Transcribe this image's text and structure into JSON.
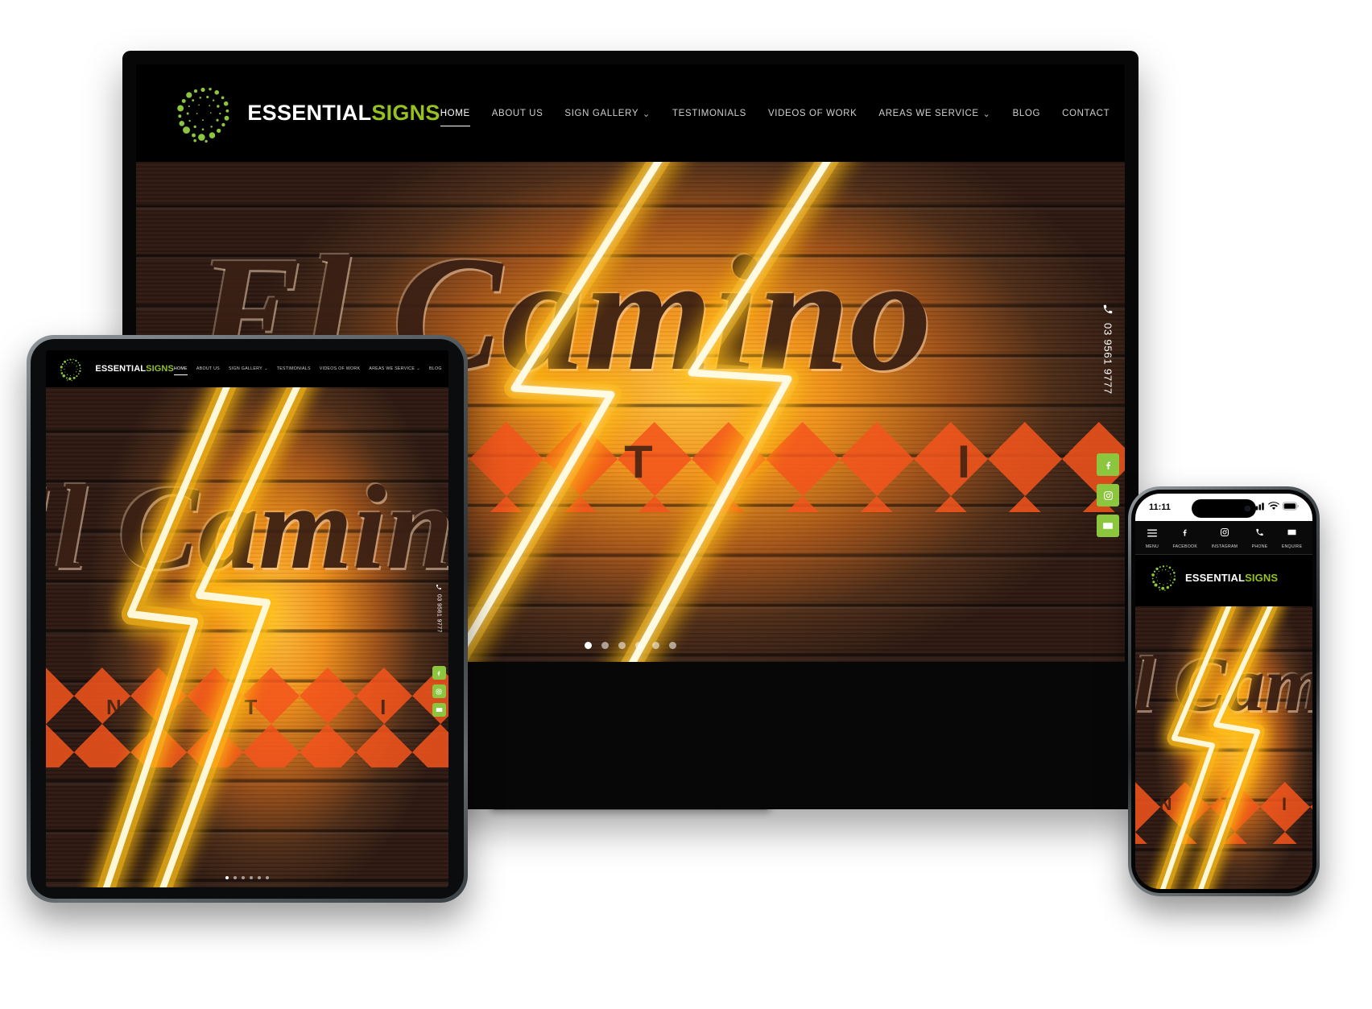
{
  "brand": {
    "name_part1": "ESSENTIAL",
    "name_part2": "SIGNS",
    "logo_icon": "dot-swirl-logo-icon",
    "accent_color": "#96c11f",
    "button_green": "#8cc63e"
  },
  "nav": {
    "items": [
      {
        "label": "HOME",
        "active": true,
        "has_dropdown": false
      },
      {
        "label": "ABOUT US",
        "active": false,
        "has_dropdown": false
      },
      {
        "label": "SIGN GALLERY",
        "active": false,
        "has_dropdown": true
      },
      {
        "label": "TESTIMONIALS",
        "active": false,
        "has_dropdown": false
      },
      {
        "label": "VIDEOS OF WORK",
        "active": false,
        "has_dropdown": false
      },
      {
        "label": "AREAS WE SERVICE",
        "active": false,
        "has_dropdown": true
      },
      {
        "label": "BLOG",
        "active": false,
        "has_dropdown": false
      },
      {
        "label": "CONTACT",
        "active": false,
        "has_dropdown": false
      }
    ]
  },
  "rail": {
    "phone_number": "03 9561 9777",
    "phone_icon": "phone-handset-icon",
    "socials": [
      {
        "name": "facebook",
        "icon": "facebook-icon"
      },
      {
        "name": "instagram",
        "icon": "instagram-icon"
      },
      {
        "name": "email",
        "icon": "envelope-icon"
      }
    ]
  },
  "hero": {
    "image_alt": "El Camino neon lightning bolt sign on reclaimed timber wall",
    "script_text": "El Camino",
    "diamond_letters": [
      "N",
      "T",
      "I"
    ],
    "slider_dots": 6,
    "active_dot": 1
  },
  "phone_device": {
    "status_time": "11:11",
    "signal_icon": "cellular-bars-icon",
    "wifi_icon": "wifi-icon",
    "battery_icon": "battery-icon",
    "quick_nav": [
      {
        "label": "MENU",
        "icon": "hamburger-icon"
      },
      {
        "label": "FACEBOOK",
        "icon": "facebook-icon"
      },
      {
        "label": "INSTAGRAM",
        "icon": "instagram-icon"
      },
      {
        "label": "PHONE",
        "icon": "phone-handset-icon"
      },
      {
        "label": "ENQUIRE",
        "icon": "envelope-icon"
      }
    ]
  }
}
